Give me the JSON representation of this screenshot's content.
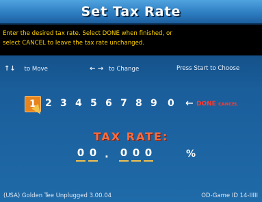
{
  "header": {
    "title": "Set Tax Rate"
  },
  "instructions": {
    "line1": "Enter the desired tax rate.  Select DONE when finished, or",
    "line2": "select CANCEL to leave the tax rate unchanged."
  },
  "hints": {
    "move_glyph": "↑↓",
    "move_label": "to Move",
    "change_glyph": "← →",
    "change_label": "to Change",
    "start_label": "Press Start to Choose"
  },
  "keypad": {
    "keys": [
      "1",
      "2",
      "3",
      "4",
      "5",
      "6",
      "7",
      "8",
      "9",
      "0"
    ],
    "selected_index": 0,
    "backspace_glyph": "←",
    "done_label": "DONE",
    "cancel_label": "CANCEL"
  },
  "tax": {
    "label": "TAX RATE:",
    "digits": [
      "0",
      "0",
      ".",
      "0",
      "0",
      "0"
    ],
    "percent": "%"
  },
  "footer": {
    "left": "(USA) Golden Tee Unplugged 3.00.04",
    "right": "OD-Game ID 14-IIIII"
  },
  "colors": {
    "accent": "#e8841c",
    "instruction_text": "#ffd200",
    "done_cancel": "#ff3b30",
    "tax_label": "#ff6a3a"
  }
}
